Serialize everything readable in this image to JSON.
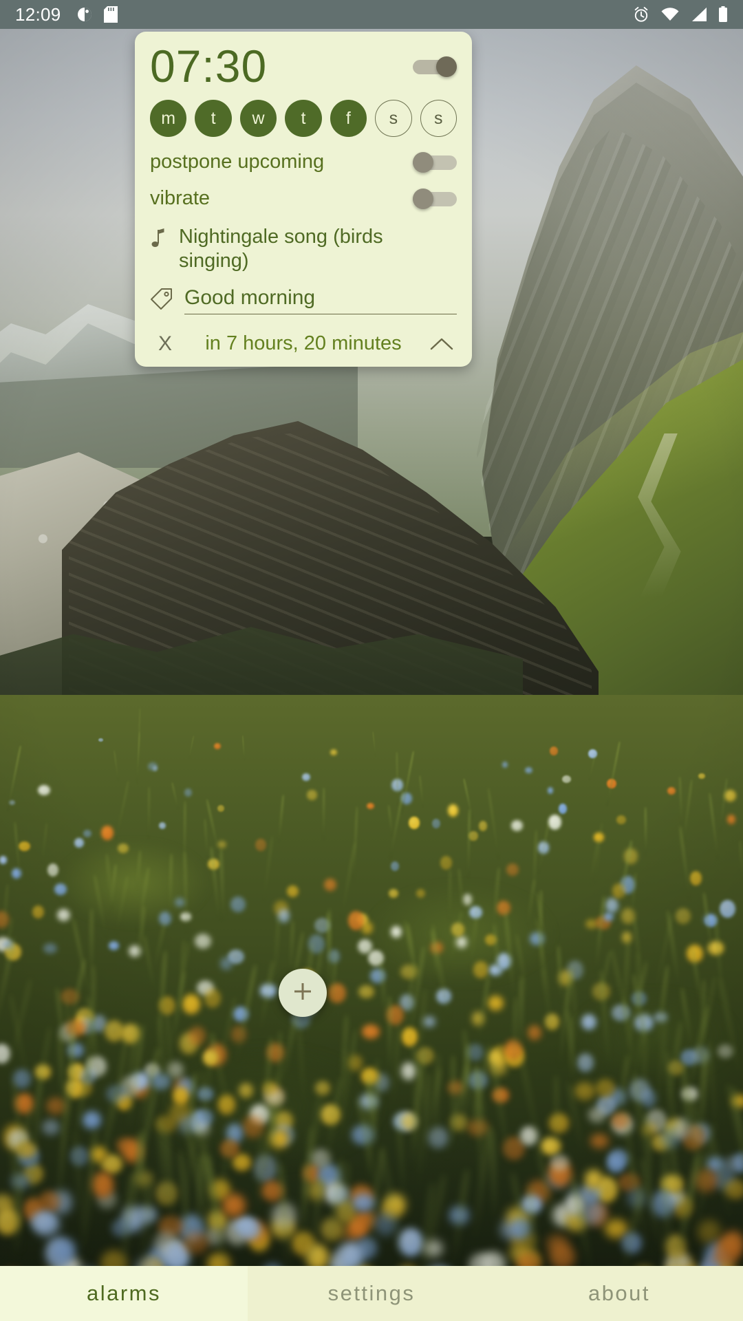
{
  "status_bar": {
    "time": "12:09",
    "left_icons": [
      "do-not-disturb-icon",
      "sd-card-icon"
    ],
    "right_icons": [
      "alarm-icon",
      "wifi-icon",
      "signal-icon",
      "battery-icon"
    ],
    "background_color": "#62706f"
  },
  "alarm_card": {
    "time": "07:30",
    "enabled": true,
    "enabled_toggle_state": "on",
    "days": [
      {
        "letter": "m",
        "active": true
      },
      {
        "letter": "t",
        "active": true
      },
      {
        "letter": "w",
        "active": true
      },
      {
        "letter": "t",
        "active": true
      },
      {
        "letter": "f",
        "active": true
      },
      {
        "letter": "s",
        "active": false
      },
      {
        "letter": "s",
        "active": false
      }
    ],
    "settings": [
      {
        "label": "postpone upcoming",
        "state": "off"
      },
      {
        "label": "vibrate",
        "state": "off"
      }
    ],
    "sound": {
      "icon": "music-note-icon",
      "name": "Nightingale song (birds singing)"
    },
    "label": {
      "icon": "tag-icon",
      "value": "Good morning",
      "placeholder": "label"
    },
    "delete_label": "X",
    "countdown": "in 7 hours, 20 minutes",
    "collapse_icon": "chevron-up-icon",
    "card_color": "#eef3d4",
    "accent_color": "#4f6b28"
  },
  "fab": {
    "icon": "plus-icon",
    "label": "+"
  },
  "tab_bar": {
    "tabs": [
      {
        "label": "alarms",
        "active": true
      },
      {
        "label": "settings",
        "active": false
      },
      {
        "label": "about",
        "active": false
      }
    ]
  }
}
